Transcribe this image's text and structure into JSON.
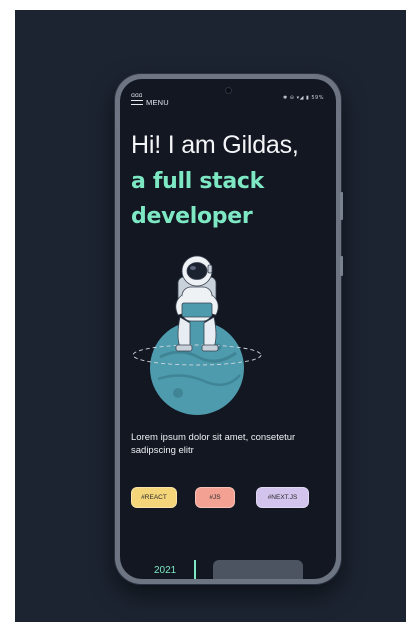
{
  "status_bar": {
    "icons": "✱ ⊖ ▾◢ ▮ 59%"
  },
  "menu": {
    "icon": "hamburger-icon",
    "glyph": "ᗡᗡᗡ",
    "label": "MENU"
  },
  "hero": {
    "line1": "Hi! I am Gildas,",
    "line2": "a full stack",
    "line3": "developer"
  },
  "illustration": {
    "subject": "astronaut-on-planet"
  },
  "subtitle": "Lorem ipsum dolor sit amet, consetetur sadipscing elitr",
  "tags": {
    "react": "#REACT",
    "js": "#JS",
    "next": "#NEXT.JS"
  },
  "timeline": {
    "year": "2021"
  },
  "colors": {
    "background": "#1c2431",
    "screen": "#121722",
    "accent": "#7de8c3",
    "planet": "#4e9bae",
    "tag_react": "#f4d57a",
    "tag_js": "#f2a193",
    "tag_next": "#d2c4ec"
  }
}
